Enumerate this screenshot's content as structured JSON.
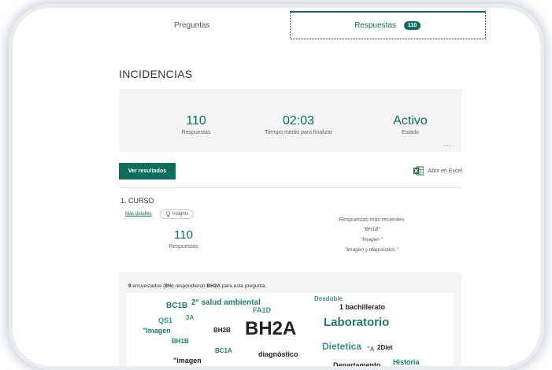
{
  "tabs": {
    "questions_label": "Preguntas",
    "responses_label": "Respuestas",
    "responses_count": "110"
  },
  "form": {
    "title": "INCIDENCIAS"
  },
  "summary": {
    "responses_value": "110",
    "responses_label": "Respuestas",
    "avg_time_value": "02:03",
    "avg_time_label": "Tiempo medio para finalizar",
    "status_value": "Activo",
    "status_label": "Estado",
    "more_label": "..."
  },
  "toolbar": {
    "view_results_label": "Ver resultados",
    "open_excel_label": "Abrir en Excel"
  },
  "question": {
    "title": "1. CURSO",
    "more_details_label": "Más detalles",
    "insights_label": "Insights",
    "responses_value": "110",
    "responses_label": "Respuestas",
    "recent_title": "Respuestas más recientes",
    "recent": [
      "\"BH1B\"",
      "\"Imagen \"",
      "\"Imagen y diagnóstico \""
    ]
  },
  "cloud": {
    "caption_count": "9",
    "caption_text_1": " encuestados (",
    "caption_pct": "8%",
    "caption_text_2": ") respondieron ",
    "caption_word": "BH2A",
    "caption_text_3": " para esta pregunta.",
    "words": [
      {
        "text": "BC1B",
        "size": 10,
        "tone": "teal"
      },
      {
        "text": "2° salud ambiental",
        "size": 10,
        "tone": "teal"
      },
      {
        "text": "FA1D",
        "size": 9,
        "tone": "teal2"
      },
      {
        "text": "Desdoble",
        "size": 8,
        "tone": "teal2"
      },
      {
        "text": "1 bachillerato",
        "size": 9,
        "tone": "dark"
      },
      {
        "text": "QS1",
        "size": 9,
        "tone": "teal2"
      },
      {
        "text": "3A",
        "size": 8,
        "tone": "teal2"
      },
      {
        "text": "\"Imagen",
        "size": 9,
        "tone": "teal"
      },
      {
        "text": "BH2B",
        "size": 8,
        "tone": "dark"
      },
      {
        "text": "BH2A",
        "size": 24,
        "tone": "dark"
      },
      {
        "text": "Laboratorio",
        "size": 15,
        "tone": "teal"
      },
      {
        "text": "BH1B",
        "size": 8,
        "tone": "teal"
      },
      {
        "text": "Dietetica",
        "size": 12,
        "tone": "teal2"
      },
      {
        "text": "\"A",
        "size": 8,
        "tone": "teal2"
      },
      {
        "text": "2Diet",
        "size": 8,
        "tone": "dark"
      },
      {
        "text": "BC1A",
        "size": 8,
        "tone": "teal"
      },
      {
        "text": "diagnóstico",
        "size": 9,
        "tone": "dark"
      },
      {
        "text": "\"imagen",
        "size": 9,
        "tone": "dark"
      },
      {
        "text": "Historia",
        "size": 9,
        "tone": "teal"
      },
      {
        "text": "Departamento",
        "size": 9,
        "tone": "dark"
      }
    ]
  },
  "colors": {
    "accent": "#0e6e5c",
    "excel_green": "#1d6f42",
    "panel_bg": "#f4f4f4"
  },
  "icons": {
    "excel": "excel-icon",
    "insights": "lightbulb-icon"
  }
}
